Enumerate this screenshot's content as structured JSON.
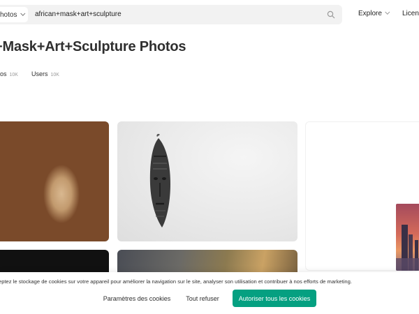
{
  "header": {
    "scope_label": "hotos",
    "search_query": "african+mask+art+sculpture",
    "nav": {
      "explore": "Explore",
      "license": "Licens"
    }
  },
  "page": {
    "title": "+Mask+Art+Sculpture Photos",
    "tabs": [
      {
        "label": "os",
        "count": "10K"
      },
      {
        "label": "Users",
        "count": "10K"
      }
    ]
  },
  "cookie_banner": {
    "text": "eptez le stockage de cookies sur votre appareil pour améliorer la navigation sur le site, analyser son utilisation et contribuer à nos efforts de marketing.",
    "settings_label": "Paramètres des cookies",
    "refuse_label": "Tout refuser",
    "accept_label": "Autoriser tous les cookies",
    "accept_color": "#05a081"
  },
  "icons": {
    "search": "search-icon",
    "dropdown": "chevron-down-icon"
  }
}
